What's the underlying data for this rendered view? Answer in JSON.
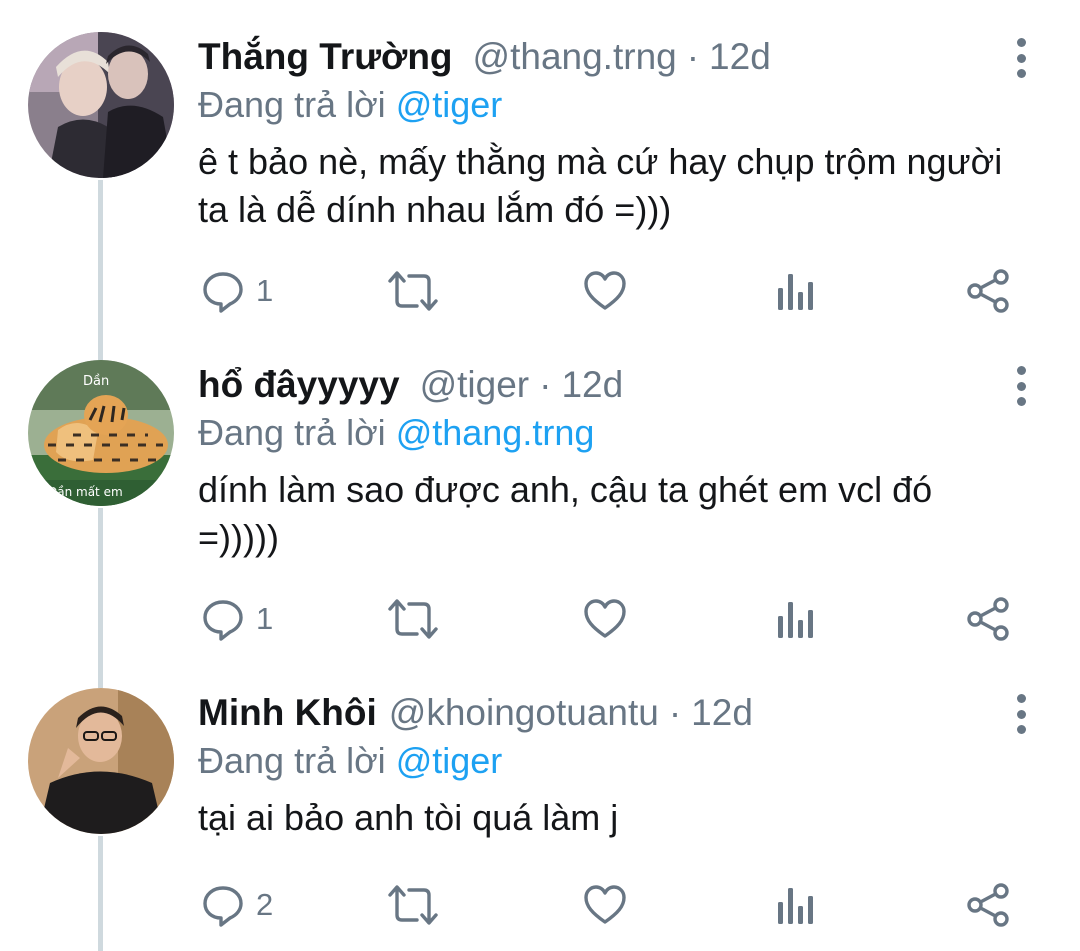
{
  "tweets": [
    {
      "name": "Thắng Trường",
      "handle": "@thang.trng",
      "separator": "·",
      "time": "12d",
      "reply_prefix": "Đang trả lời",
      "reply_to": "@tiger",
      "text": "ê t bảo nè, mấy thằng mà cứ hay chụp trộm người ta là dễ dính nhau lắm đó =)))",
      "reply_count": "1"
    },
    {
      "name": "hổ đâyyyyy",
      "handle": "@tiger",
      "separator": "·",
      "time": "12d",
      "reply_prefix": "Đang trả lời",
      "reply_to": "@thang.trng",
      "text": "dính làm sao được anh, cậu ta ghét em vcl đó =)))))",
      "reply_count": "1",
      "avatar_caption_top": "Dần",
      "avatar_caption_bottom": "Dần mất em"
    },
    {
      "name": "Minh Khôi",
      "handle": "@khoingotuantu",
      "separator": "·",
      "time": "12d",
      "reply_prefix": "Đang trả lời",
      "reply_to": "@tiger",
      "text": "tại ai bảo anh tòi quá làm j",
      "reply_count": "2"
    }
  ],
  "icons": {
    "reply": "reply-icon",
    "retweet": "retweet-icon",
    "like": "heart-icon",
    "analytics": "analytics-icon",
    "share": "share-icon",
    "more": "more-vertical-icon"
  },
  "colors": {
    "link": "#1da1f2",
    "secondary_text": "#687684",
    "thread_line": "#cfd9de"
  }
}
